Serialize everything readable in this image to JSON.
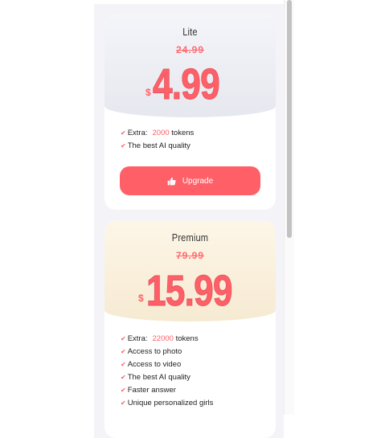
{
  "plans": {
    "lite": {
      "name": "Lite",
      "old_price": "24.99",
      "currency": "$",
      "price": "4.99",
      "features": [
        {
          "label": "Extra:",
          "accent": "2000",
          "suffix": "tokens"
        },
        {
          "label": "The best AI quality"
        }
      ],
      "button_label": "Upgrade",
      "button_icon": "thumbs-up-icon"
    },
    "premium": {
      "name": "Premium",
      "old_price": "79.99",
      "currency": "$",
      "price": "15.99",
      "features": [
        {
          "label": "Extra:",
          "accent": "22000",
          "suffix": "tokens"
        },
        {
          "label": "Access to photo"
        },
        {
          "label": "Access to video"
        },
        {
          "label": "The best AI quality"
        },
        {
          "label": "Faster answer"
        },
        {
          "label": "Unique personalized girls"
        }
      ]
    }
  },
  "colors": {
    "accent": "#ff6068",
    "lite_hero": "#e6e8ef",
    "premium_hero": "#f6ead2",
    "panel": "#f4f4f8"
  }
}
